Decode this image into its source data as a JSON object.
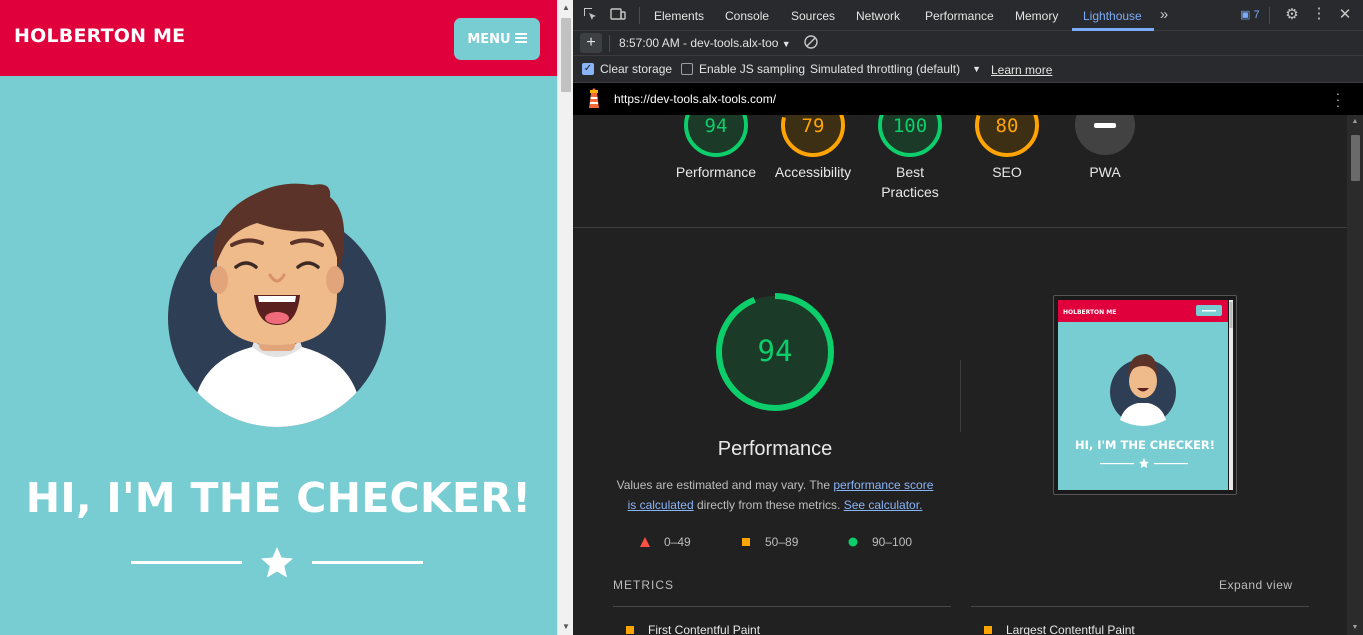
{
  "site": {
    "title": "HOLBERTON ME",
    "menu_label": "MENU",
    "heading": "HI, I'M THE CHECKER!",
    "colors": {
      "nav": "#e0003c",
      "background": "#78cdd3"
    }
  },
  "devtools": {
    "tabs": [
      "Elements",
      "Console",
      "Sources",
      "Network",
      "Performance",
      "Memory",
      "Lighthouse"
    ],
    "active_tab": "Lighthouse",
    "issues_count": "7",
    "report_select": "8:57:00 AM - dev-tools.alx-too",
    "options": {
      "clear_storage": "Clear storage",
      "clear_storage_checked": true,
      "js_sampling": "Enable JS sampling",
      "js_sampling_checked": false,
      "throttling": "Simulated throttling (default)",
      "learn_more": "Learn more"
    },
    "url": "https://dev-tools.alx-tools.com/"
  },
  "lighthouse": {
    "gauges": [
      {
        "label": "Performance",
        "score": "94",
        "color": "#0cce6b"
      },
      {
        "label": "Accessibility",
        "score": "79",
        "color": "#ffa400"
      },
      {
        "label": "Best Practices",
        "score": "100",
        "color": "#0cce6b"
      },
      {
        "label": "SEO",
        "score": "80",
        "color": "#ffa400"
      },
      {
        "label": "PWA",
        "score": "",
        "color": "#9e9e9e"
      }
    ],
    "performance": {
      "score": "94",
      "title": "Performance",
      "desc_prefix": "Values are estimated and may vary. The ",
      "desc_link1": "performance score is calculated",
      "desc_middle": " directly from these metrics. ",
      "desc_link2": "See calculator."
    },
    "legend": [
      {
        "range": "0–49",
        "color": "#ff4e42"
      },
      {
        "range": "50–89",
        "color": "#ffa400"
      },
      {
        "range": "90–100",
        "color": "#0cce6b"
      }
    ],
    "thumbnail": {
      "title": "HOLBERTON ME",
      "heading": "HI, I'M THE CHECKER!"
    },
    "metrics_title": "METRICS",
    "expand_view": "Expand view",
    "metrics": [
      "First Contentful Paint",
      "Largest Contentful Paint"
    ]
  }
}
